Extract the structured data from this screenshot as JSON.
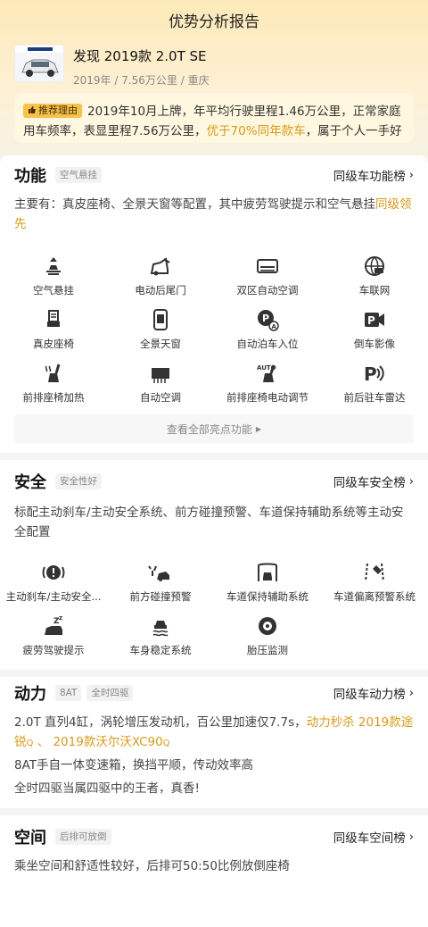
{
  "header": {
    "title": "优势分析报告"
  },
  "car": {
    "title": "发现 2019款 2.0T SE",
    "meta": "2019年 / 7.56万公里 / 重庆"
  },
  "reason": {
    "tag": "推荐理由",
    "text_a": "2019年10月上牌，年平均行驶里程1.46万公里，正常家庭用车频率，表显里程7.56万公里，",
    "text_highlight": "优于70%同年款车",
    "text_b": "，属于个人一手好车"
  },
  "function": {
    "title": "功能",
    "tag": "空气悬挂",
    "link": "同级车功能榜",
    "desc": "主要有：真皮座椅、全景天窗等配置，其中疲劳驾驶提示和空气悬挂",
    "desc_highlight": "同级领先",
    "items": [
      {
        "label": "空气悬挂",
        "icon": "air-suspension-icon"
      },
      {
        "label": "电动后尾门",
        "icon": "power-tailgate-icon"
      },
      {
        "label": "双区自动空调",
        "icon": "dual-zone-ac-icon"
      },
      {
        "label": "车联网",
        "icon": "connected-car-icon"
      },
      {
        "label": "真皮座椅",
        "icon": "leather-seat-icon"
      },
      {
        "label": "全景天窗",
        "icon": "panoramic-sunroof-icon"
      },
      {
        "label": "自动泊车入位",
        "icon": "auto-parking-icon"
      },
      {
        "label": "倒车影像",
        "icon": "reverse-camera-icon"
      },
      {
        "label": "前排座椅加热",
        "icon": "seat-heating-icon"
      },
      {
        "label": "自动空调",
        "icon": "auto-ac-icon"
      },
      {
        "label": "前排座椅电动调节",
        "icon": "power-seat-icon"
      },
      {
        "label": "前后驻车雷达",
        "icon": "parking-radar-icon"
      }
    ],
    "more": "查看全部亮点功能"
  },
  "safety": {
    "title": "安全",
    "tag": "安全性好",
    "link": "同级车安全榜",
    "desc": "标配主动刹车/主动安全系统、前方碰撞预警、车道保持辅助系统等主动安全配置",
    "items": [
      {
        "label": "主动刹车/主动安全...",
        "icon": "active-brake-icon"
      },
      {
        "label": "前方碰撞预警",
        "icon": "collision-warning-icon"
      },
      {
        "label": "车道保持辅助系统",
        "icon": "lane-keep-icon"
      },
      {
        "label": "车道偏离预警系统",
        "icon": "lane-departure-icon"
      },
      {
        "label": "疲劳驾驶提示",
        "icon": "fatigue-alert-icon"
      },
      {
        "label": "车身稳定系统",
        "icon": "stability-control-icon"
      },
      {
        "label": "胎压监测",
        "icon": "tire-pressure-icon"
      }
    ]
  },
  "power": {
    "title": "动力",
    "tag1": "8AT",
    "tag2": "全时四驱",
    "link": "同级车动力榜",
    "line1": "2.0T 直列4缸，涡轮增压发动机，百公里加速仅7.7s，",
    "line1_highlight": "动力秒杀",
    "compare1": "2019款途锐",
    "sep": "、",
    "compare2": "2019款沃尔沃XC90",
    "line2": "8AT手自一体变速箱，换挡平顺，传动效率高",
    "line3": "全时四驱当属四驱中的王者，真香!"
  },
  "space": {
    "title": "空间",
    "tag": "后排可放倒",
    "link": "同级车空间榜",
    "desc": "乘坐空间和舒适性较好，后排可50:50比例放倒座椅"
  },
  "colors": {
    "accent": "#d69a1a",
    "tag_bg": "#f5c24c"
  }
}
